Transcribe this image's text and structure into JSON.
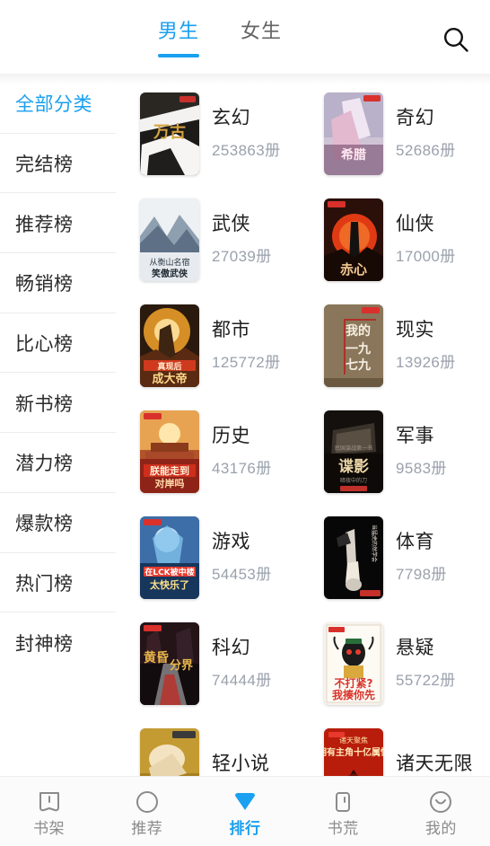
{
  "header": {
    "tabs": [
      {
        "label": "男生",
        "active": true
      },
      {
        "label": "女生",
        "active": false
      }
    ],
    "search_icon": "search-icon",
    "active_color": "#1aa0f0"
  },
  "sidebar": {
    "items": [
      {
        "label": "全部分类",
        "active": true
      },
      {
        "label": "完结榜",
        "active": false
      },
      {
        "label": "推荐榜",
        "active": false
      },
      {
        "label": "畅销榜",
        "active": false
      },
      {
        "label": "比心榜",
        "active": false
      },
      {
        "label": "新书榜",
        "active": false
      },
      {
        "label": "潜力榜",
        "active": false
      },
      {
        "label": "爆款榜",
        "active": false
      },
      {
        "label": "热门榜",
        "active": false
      },
      {
        "label": "封神榜",
        "active": false
      }
    ]
  },
  "grid": {
    "count_unit": "册",
    "items": [
      {
        "title": "玄幻",
        "count": "253863册",
        "cover": "wangu-shendi"
      },
      {
        "title": "奇幻",
        "count": "52686册",
        "cover": "xila-daimengren"
      },
      {
        "title": "武侠",
        "count": "27039册",
        "cover": "hengshan-mingsu"
      },
      {
        "title": "仙侠",
        "count": "17000册",
        "cover": "chixin-xuntian"
      },
      {
        "title": "都市",
        "count": "125772册",
        "cover": "chengda-di"
      },
      {
        "title": "现实",
        "count": "13926册",
        "cover": "wode-yijiuqijiu"
      },
      {
        "title": "历史",
        "count": "43176册",
        "cover": "zhen-neng-zoudao"
      },
      {
        "title": "军事",
        "count": "9583册",
        "cover": "dieying"
      },
      {
        "title": "游戏",
        "count": "54453册",
        "cover": "lck-kuaile"
      },
      {
        "title": "体育",
        "count": "7798册",
        "cover": "ranshaoxue"
      },
      {
        "title": "科幻",
        "count": "74444册",
        "cover": "huanghun-fenjie"
      },
      {
        "title": "悬疑",
        "count": "55722册",
        "cover": "budaqiang"
      },
      {
        "title": "轻小说",
        "count": "",
        "cover": "qingxiaoshuo"
      },
      {
        "title": "诸天无限",
        "count": "",
        "cover": "zhutian-wuxian"
      }
    ]
  },
  "bottom_nav": {
    "items": [
      {
        "label": "书架",
        "icon": "bookshelf-icon",
        "active": false
      },
      {
        "label": "推荐",
        "icon": "compass-icon",
        "active": false
      },
      {
        "label": "排行",
        "icon": "diamond-icon",
        "active": true
      },
      {
        "label": "书荒",
        "icon": "book-single-icon",
        "active": false
      },
      {
        "label": "我的",
        "icon": "smiley-face-icon",
        "active": false
      }
    ]
  }
}
